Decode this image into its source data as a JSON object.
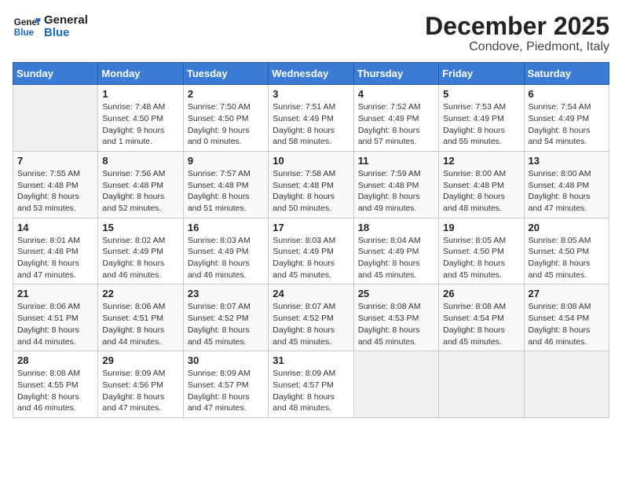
{
  "header": {
    "logo_line1": "General",
    "logo_line2": "Blue",
    "month_title": "December 2025",
    "location": "Condove, Piedmont, Italy"
  },
  "days_of_week": [
    "Sunday",
    "Monday",
    "Tuesday",
    "Wednesday",
    "Thursday",
    "Friday",
    "Saturday"
  ],
  "weeks": [
    [
      {
        "day": "",
        "info": ""
      },
      {
        "day": "1",
        "info": "Sunrise: 7:48 AM\nSunset: 4:50 PM\nDaylight: 9 hours\nand 1 minute."
      },
      {
        "day": "2",
        "info": "Sunrise: 7:50 AM\nSunset: 4:50 PM\nDaylight: 9 hours\nand 0 minutes."
      },
      {
        "day": "3",
        "info": "Sunrise: 7:51 AM\nSunset: 4:49 PM\nDaylight: 8 hours\nand 58 minutes."
      },
      {
        "day": "4",
        "info": "Sunrise: 7:52 AM\nSunset: 4:49 PM\nDaylight: 8 hours\nand 57 minutes."
      },
      {
        "day": "5",
        "info": "Sunrise: 7:53 AM\nSunset: 4:49 PM\nDaylight: 8 hours\nand 55 minutes."
      },
      {
        "day": "6",
        "info": "Sunrise: 7:54 AM\nSunset: 4:49 PM\nDaylight: 8 hours\nand 54 minutes."
      }
    ],
    [
      {
        "day": "7",
        "info": "Sunrise: 7:55 AM\nSunset: 4:48 PM\nDaylight: 8 hours\nand 53 minutes."
      },
      {
        "day": "8",
        "info": "Sunrise: 7:56 AM\nSunset: 4:48 PM\nDaylight: 8 hours\nand 52 minutes."
      },
      {
        "day": "9",
        "info": "Sunrise: 7:57 AM\nSunset: 4:48 PM\nDaylight: 8 hours\nand 51 minutes."
      },
      {
        "day": "10",
        "info": "Sunrise: 7:58 AM\nSunset: 4:48 PM\nDaylight: 8 hours\nand 50 minutes."
      },
      {
        "day": "11",
        "info": "Sunrise: 7:59 AM\nSunset: 4:48 PM\nDaylight: 8 hours\nand 49 minutes."
      },
      {
        "day": "12",
        "info": "Sunrise: 8:00 AM\nSunset: 4:48 PM\nDaylight: 8 hours\nand 48 minutes."
      },
      {
        "day": "13",
        "info": "Sunrise: 8:00 AM\nSunset: 4:48 PM\nDaylight: 8 hours\nand 47 minutes."
      }
    ],
    [
      {
        "day": "14",
        "info": "Sunrise: 8:01 AM\nSunset: 4:48 PM\nDaylight: 8 hours\nand 47 minutes."
      },
      {
        "day": "15",
        "info": "Sunrise: 8:02 AM\nSunset: 4:49 PM\nDaylight: 8 hours\nand 46 minutes."
      },
      {
        "day": "16",
        "info": "Sunrise: 8:03 AM\nSunset: 4:49 PM\nDaylight: 8 hours\nand 46 minutes."
      },
      {
        "day": "17",
        "info": "Sunrise: 8:03 AM\nSunset: 4:49 PM\nDaylight: 8 hours\nand 45 minutes."
      },
      {
        "day": "18",
        "info": "Sunrise: 8:04 AM\nSunset: 4:49 PM\nDaylight: 8 hours\nand 45 minutes."
      },
      {
        "day": "19",
        "info": "Sunrise: 8:05 AM\nSunset: 4:50 PM\nDaylight: 8 hours\nand 45 minutes."
      },
      {
        "day": "20",
        "info": "Sunrise: 8:05 AM\nSunset: 4:50 PM\nDaylight: 8 hours\nand 45 minutes."
      }
    ],
    [
      {
        "day": "21",
        "info": "Sunrise: 8:06 AM\nSunset: 4:51 PM\nDaylight: 8 hours\nand 44 minutes."
      },
      {
        "day": "22",
        "info": "Sunrise: 8:06 AM\nSunset: 4:51 PM\nDaylight: 8 hours\nand 44 minutes."
      },
      {
        "day": "23",
        "info": "Sunrise: 8:07 AM\nSunset: 4:52 PM\nDaylight: 8 hours\nand 45 minutes."
      },
      {
        "day": "24",
        "info": "Sunrise: 8:07 AM\nSunset: 4:52 PM\nDaylight: 8 hours\nand 45 minutes."
      },
      {
        "day": "25",
        "info": "Sunrise: 8:08 AM\nSunset: 4:53 PM\nDaylight: 8 hours\nand 45 minutes."
      },
      {
        "day": "26",
        "info": "Sunrise: 8:08 AM\nSunset: 4:54 PM\nDaylight: 8 hours\nand 45 minutes."
      },
      {
        "day": "27",
        "info": "Sunrise: 8:08 AM\nSunset: 4:54 PM\nDaylight: 8 hours\nand 46 minutes."
      }
    ],
    [
      {
        "day": "28",
        "info": "Sunrise: 8:08 AM\nSunset: 4:55 PM\nDaylight: 8 hours\nand 46 minutes."
      },
      {
        "day": "29",
        "info": "Sunrise: 8:09 AM\nSunset: 4:56 PM\nDaylight: 8 hours\nand 47 minutes."
      },
      {
        "day": "30",
        "info": "Sunrise: 8:09 AM\nSunset: 4:57 PM\nDaylight: 8 hours\nand 47 minutes."
      },
      {
        "day": "31",
        "info": "Sunrise: 8:09 AM\nSunset: 4:57 PM\nDaylight: 8 hours\nand 48 minutes."
      },
      {
        "day": "",
        "info": ""
      },
      {
        "day": "",
        "info": ""
      },
      {
        "day": "",
        "info": ""
      }
    ]
  ]
}
